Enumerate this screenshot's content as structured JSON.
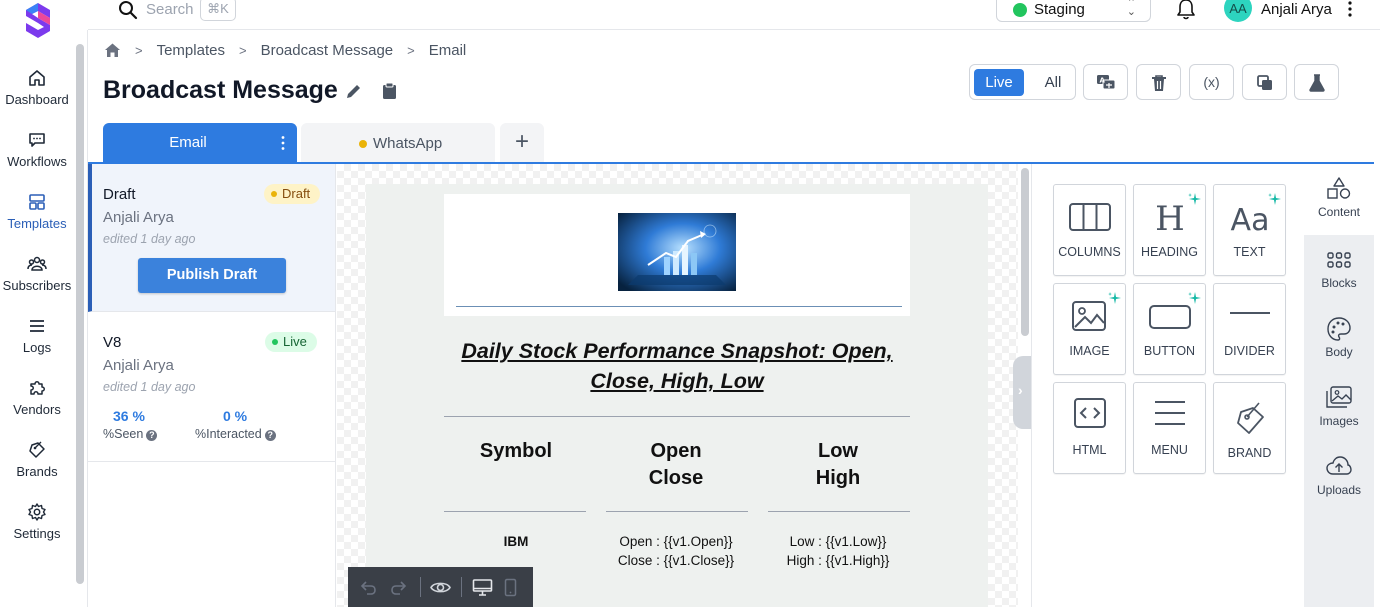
{
  "nav": {
    "items": [
      {
        "label": "Dashboard",
        "icon": "home-icon"
      },
      {
        "label": "Workflows",
        "icon": "message-icon"
      },
      {
        "label": "Templates",
        "icon": "templates-icon"
      },
      {
        "label": "Subscribers",
        "icon": "users-icon"
      },
      {
        "label": "Logs",
        "icon": "list-icon"
      },
      {
        "label": "Vendors",
        "icon": "puzzle-icon"
      },
      {
        "label": "Brands",
        "icon": "brand-tag-icon"
      },
      {
        "label": "Settings",
        "icon": "gear-icon"
      }
    ],
    "active": "Templates"
  },
  "topbar": {
    "search_placeholder": "Search",
    "shortcut": "⌘K",
    "environment": "Staging",
    "avatar_initials": "AA",
    "user_name": "Anjali Arya"
  },
  "breadcrumb": [
    "Templates",
    "Broadcast Message",
    "Email"
  ],
  "page": {
    "title": "Broadcast Message"
  },
  "toolbar": {
    "live_label": "Live",
    "all_label": "All",
    "variable_label": "(x)"
  },
  "channels": {
    "email": "Email",
    "whatsapp": "WhatsApp",
    "add": "+"
  },
  "versions": [
    {
      "name": "Draft",
      "badge": "Draft",
      "author": "Anjali Arya",
      "edited": "edited 1 day ago",
      "action": "Publish Draft"
    },
    {
      "name": "V8",
      "badge": "Live",
      "author": "Anjali Arya",
      "edited": "edited 1 day ago",
      "seen_value": "36 %",
      "seen_label": "%Seen",
      "interacted_value": "0 %",
      "interacted_label": "%Interacted"
    }
  ],
  "email": {
    "title": "Daily Stock Performance Snapshot: Open, Close, High, Low",
    "headers": {
      "symbol": "Symbol",
      "open": "Open",
      "close": "Close",
      "low": "Low",
      "high": "High"
    },
    "row": {
      "symbol": "IBM",
      "open": "Open : {{v1.Open}}",
      "close": "Close : {{v1.Close}}",
      "low": "Low : {{v1.Low}}",
      "high": "High : {{v1.High}}"
    }
  },
  "content_blocks": [
    {
      "label": "COLUMNS",
      "icon": "columns-icon"
    },
    {
      "label": "HEADING",
      "icon": "heading-icon"
    },
    {
      "label": "TEXT",
      "icon": "text-icon"
    },
    {
      "label": "IMAGE",
      "icon": "image-icon"
    },
    {
      "label": "BUTTON",
      "icon": "button-icon"
    },
    {
      "label": "DIVIDER",
      "icon": "divider-icon"
    },
    {
      "label": "HTML",
      "icon": "html-icon"
    },
    {
      "label": "MENU",
      "icon": "menu-icon"
    },
    {
      "label": "BRAND",
      "icon": "brand-icon"
    }
  ],
  "side_tabs": [
    {
      "label": "Content",
      "icon": "shapes-icon"
    },
    {
      "label": "Blocks",
      "icon": "grid-icon"
    },
    {
      "label": "Body",
      "icon": "palette-icon"
    },
    {
      "label": "Images",
      "icon": "images-icon"
    },
    {
      "label": "Uploads",
      "icon": "cloud-upload-icon"
    }
  ],
  "colors": {
    "primary": "#2e7be0",
    "nav_active": "#2b5fb7",
    "live_green": "#22c55e",
    "draft_yellow": "#eab308"
  }
}
